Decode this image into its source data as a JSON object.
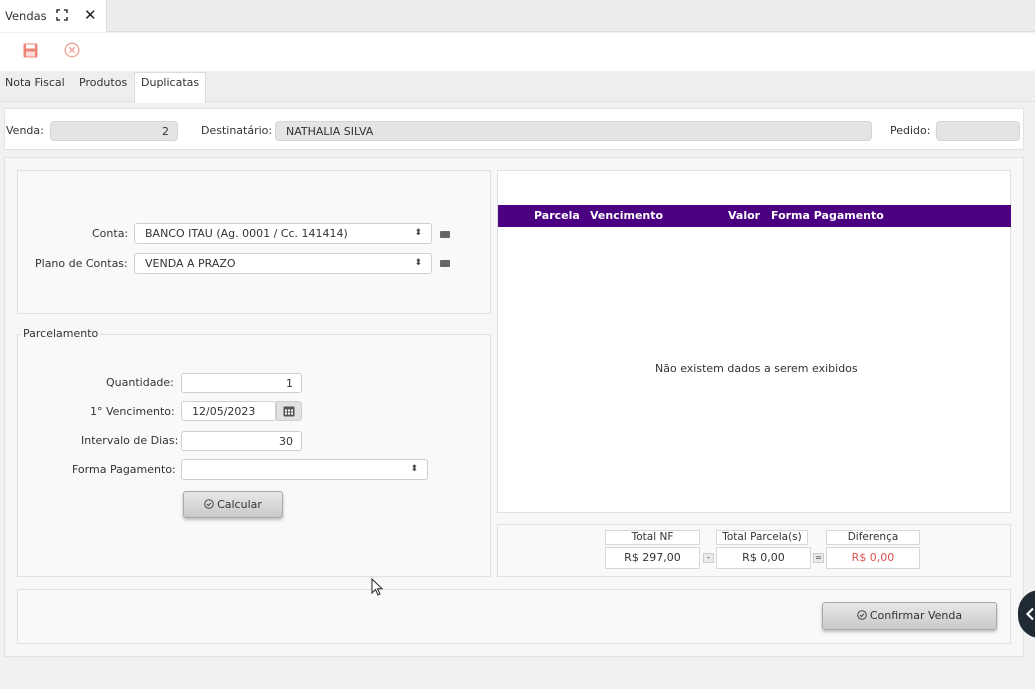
{
  "window": {
    "title": "Vendas"
  },
  "tabs": [
    {
      "label": "Nota Fiscal",
      "active": false
    },
    {
      "label": "Produtos",
      "active": false
    },
    {
      "label": "Duplicatas",
      "active": true
    }
  ],
  "header": {
    "venda_label": "Venda:",
    "venda_value": "2",
    "destinatario_label": "Destinatário:",
    "destinatario_value": "NATHALIA SILVA",
    "pedido_label": "Pedido:",
    "pedido_value": ""
  },
  "conta": {
    "conta_label": "Conta:",
    "conta_value": "BANCO ITAU (Ag. 0001 / Cc. 141414)",
    "plano_label": "Plano de Contas:",
    "plano_value": "VENDA A PRAZO"
  },
  "parcelamento": {
    "legend": "Parcelamento",
    "quantidade_label": "Quantidade:",
    "quantidade_value": "1",
    "vencimento_label": "1° Vencimento:",
    "vencimento_value": "12/05/2023",
    "intervalo_label": "Intervalo de Dias:",
    "intervalo_value": "30",
    "forma_label": "Forma Pagamento:",
    "forma_value": "",
    "calcular_label": "Calcular"
  },
  "grid": {
    "columns": [
      "Parcela",
      "Vencimento",
      "Valor",
      "Forma Pagamento"
    ],
    "empty_message": "Não existem dados a serem exibidos"
  },
  "totals": {
    "total_nf_label": "Total NF",
    "total_nf_value": "R$ 297,00",
    "minus": "-",
    "total_parcelas_label": "Total Parcela(s)",
    "total_parcelas_value": "R$ 0,00",
    "equals": "=",
    "diferenca_label": "Diferença",
    "diferenca_value": "R$ 0,00"
  },
  "footer": {
    "confirmar_label": "Confirmar Venda"
  },
  "colors": {
    "grid_header": "#4b0082",
    "save_icon": "#e8776a",
    "diferenca_value": "#d9534f"
  }
}
